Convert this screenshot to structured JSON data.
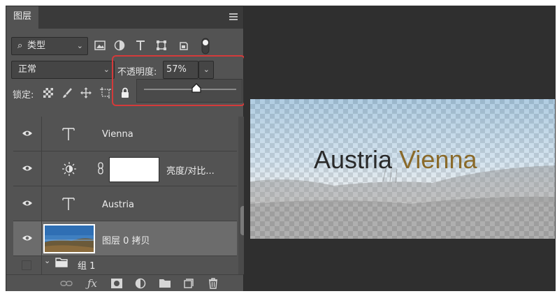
{
  "panel": {
    "tab_label": "图层",
    "filter": {
      "search_icon": "magnifier-icon",
      "label": "类型"
    },
    "blend_mode": "正常",
    "opacity": {
      "label": "不透明度:",
      "value": "57%",
      "level": 0.57
    },
    "lock": {
      "label": "锁定:"
    }
  },
  "layers": [
    {
      "type": "text",
      "name": "Vienna",
      "icon": "text-T-icon",
      "visible": true
    },
    {
      "type": "adjustment",
      "name": "亮度/对比...",
      "icon": "brightness-sun-icon",
      "visible": true
    },
    {
      "type": "text",
      "name": "Austria",
      "icon": "text-T-icon",
      "visible": true
    },
    {
      "type": "image",
      "name": "图层 0 拷贝",
      "icon": "landscape-thumbnail",
      "visible": true,
      "selected": true
    },
    {
      "type": "group",
      "name": "组 1",
      "icon": "folder-icon",
      "visible": false,
      "expanded": true
    }
  ],
  "canvas": {
    "word1": "Austria",
    "word2": "Vienna",
    "word1_color": "#2a2a2a",
    "word2_color": "#8a6a2a"
  },
  "colors": {
    "highlight": "#d43a3a",
    "panel_bg": "#535353",
    "selected_row": "#6c6c6c"
  }
}
